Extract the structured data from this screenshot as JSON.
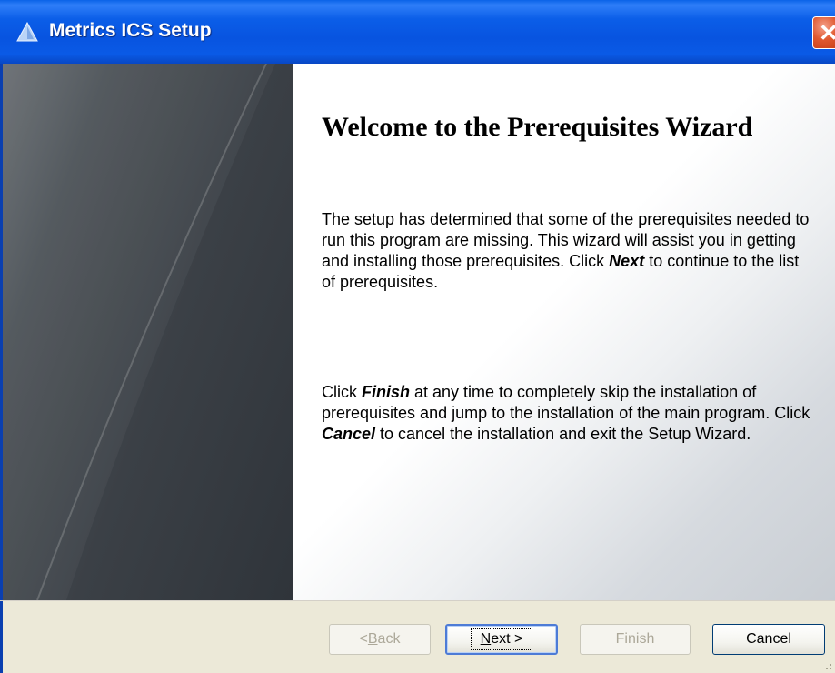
{
  "window": {
    "title": "Metrics ICS Setup",
    "title_icon": "triangle-app-icon",
    "close_icon": "close-x-icon"
  },
  "content": {
    "heading": "Welcome to the Prerequisites Wizard",
    "para1": {
      "text_before": "The setup has determined that some of the prerequisites needed to run this program are missing. This wizard will assist you in getting and installing those prerequisites. Click ",
      "emphasis_next": "Next",
      "text_after": "  to continue to the list of prerequisites."
    },
    "para2": {
      "text_start": "Click ",
      "emphasis_finish": "Finish",
      "text_mid": " at any time to completely skip the installation of prerequisites and jump to the installation of the main program. Click ",
      "emphasis_cancel": "Cancel",
      "text_end": " to cancel the installation and exit the Setup Wizard."
    }
  },
  "buttons": {
    "back": {
      "prefix": "< ",
      "mnemonic": "B",
      "rest": "ack",
      "enabled": false
    },
    "next": {
      "mnemonic": "N",
      "rest": "ext >",
      "enabled": true,
      "default": true
    },
    "finish": {
      "label": "Finish",
      "enabled": false
    },
    "cancel": {
      "label": "Cancel",
      "enabled": true
    }
  },
  "colors": {
    "titlebar": "#0a5ae6",
    "left_panel": "#3b4046",
    "dialog_bar": "#ece9d8",
    "close_button": "#e0582f"
  }
}
